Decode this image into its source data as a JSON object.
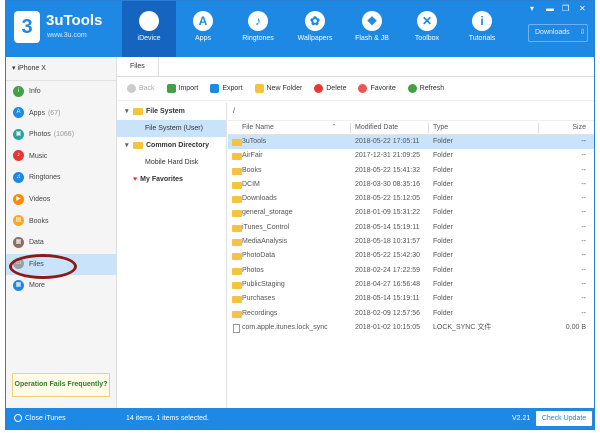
{
  "brand": {
    "name": "3uTools",
    "url": "www.3u.com",
    "logo_glyph": "3"
  },
  "nav": [
    {
      "label": "iDevice",
      "icon": "apple-icon",
      "glyph": "",
      "active": true
    },
    {
      "label": "Apps",
      "icon": "app-store-icon",
      "glyph": "A",
      "active": false
    },
    {
      "label": "Ringtones",
      "icon": "bell-icon",
      "glyph": "♪",
      "active": false
    },
    {
      "label": "Wallpapers",
      "icon": "flower-icon",
      "glyph": "✿",
      "active": false
    },
    {
      "label": "Flash & JB",
      "icon": "dropbox-icon",
      "glyph": "❖",
      "active": false
    },
    {
      "label": "Toolbox",
      "icon": "tools-icon",
      "glyph": "✕",
      "active": false
    },
    {
      "label": "Tutorials",
      "icon": "info-icon",
      "glyph": "i",
      "active": false
    }
  ],
  "downloads": {
    "label": "Downloads",
    "glyph": "⇩"
  },
  "window_controls": {
    "minimize": "▬",
    "restore": "❐",
    "close": "✕",
    "menu": "▾"
  },
  "sidebar": {
    "device": "iPhone X",
    "device_glyph": "▾",
    "items": [
      {
        "label": "Info",
        "count": "",
        "icon": "info-icon",
        "glyph": "i",
        "color": "#43a047"
      },
      {
        "label": "Apps",
        "count": "(67)",
        "icon": "apps-icon",
        "glyph": "A",
        "color": "#1e88e5"
      },
      {
        "label": "Photos",
        "count": "(1066)",
        "icon": "photos-icon",
        "glyph": "▣",
        "color": "#26a69a"
      },
      {
        "label": "Music",
        "count": "",
        "icon": "music-icon",
        "glyph": "♪",
        "color": "#e53935"
      },
      {
        "label": "Ringtones",
        "count": "",
        "icon": "bell-icon",
        "glyph": "♫",
        "color": "#1e88e5"
      },
      {
        "label": "Videos",
        "count": "",
        "icon": "video-icon",
        "glyph": "▶",
        "color": "#fb8c00"
      },
      {
        "label": "Books",
        "count": "",
        "icon": "book-icon",
        "glyph": "▤",
        "color": "#f9a825"
      },
      {
        "label": "Data",
        "count": "",
        "icon": "data-icon",
        "glyph": "▦",
        "color": "#8d6e63"
      },
      {
        "label": "Files",
        "count": "",
        "icon": "folder-icon",
        "glyph": "▭",
        "color": "#9e9e9e",
        "active": true
      },
      {
        "label": "More",
        "count": "",
        "icon": "grid-icon",
        "glyph": "▦",
        "color": "#1e88e5"
      }
    ],
    "help_link": "Operation Fails Frequently?"
  },
  "tabs": [
    {
      "label": "Files"
    }
  ],
  "toolbar": {
    "back": "Back",
    "import": "Import",
    "export": "Export",
    "new_folder": "New Folder",
    "delete": "Delete",
    "favorite": "Favorite",
    "refresh": "Refresh"
  },
  "tree": {
    "file_system": "File System",
    "file_system_user": "File System (User)",
    "common_directory": "Common Directory",
    "mobile_hard_disk": "Mobile Hard Disk",
    "my_favorites": "My Favorites"
  },
  "path": "/",
  "columns": {
    "name": "File Name",
    "date": "Modified Date",
    "type": "Type",
    "size": "Size"
  },
  "files": [
    {
      "name": "3uTools",
      "date": "2018-05-22 17:05:11",
      "type": "Folder",
      "size": "--",
      "kind": "folder"
    },
    {
      "name": "AirFair",
      "date": "2017-12-31 21:09:25",
      "type": "Folder",
      "size": "--",
      "kind": "folder"
    },
    {
      "name": "Books",
      "date": "2018-05-22 15:41:32",
      "type": "Folder",
      "size": "--",
      "kind": "folder"
    },
    {
      "name": "DCIM",
      "date": "2018-03-30 08:35:16",
      "type": "Folder",
      "size": "--",
      "kind": "folder"
    },
    {
      "name": "Downloads",
      "date": "2018-05-22 15:12:05",
      "type": "Folder",
      "size": "--",
      "kind": "folder"
    },
    {
      "name": "general_storage",
      "date": "2018-01-09 15:31:22",
      "type": "Folder",
      "size": "--",
      "kind": "folder"
    },
    {
      "name": "iTunes_Control",
      "date": "2018-05-14 15:19:11",
      "type": "Folder",
      "size": "--",
      "kind": "folder"
    },
    {
      "name": "MediaAnalysis",
      "date": "2018-05-18 10:31:57",
      "type": "Folder",
      "size": "--",
      "kind": "folder"
    },
    {
      "name": "PhotoData",
      "date": "2018-05-22 15:42:30",
      "type": "Folder",
      "size": "--",
      "kind": "folder"
    },
    {
      "name": "Photos",
      "date": "2018-02-24 17:22:59",
      "type": "Folder",
      "size": "--",
      "kind": "folder"
    },
    {
      "name": "PublicStaging",
      "date": "2018-04-27 16:56:48",
      "type": "Folder",
      "size": "--",
      "kind": "folder"
    },
    {
      "name": "Purchases",
      "date": "2018-05-14 15:19:11",
      "type": "Folder",
      "size": "--",
      "kind": "folder"
    },
    {
      "name": "Recordings",
      "date": "2018-02-09 12:57:56",
      "type": "Folder",
      "size": "--",
      "kind": "folder"
    },
    {
      "name": "com.apple.itunes.lock_sync",
      "date": "2018-01-02 10:15:05",
      "type": "LOCK_SYNC 文件",
      "size": "0.00 B",
      "kind": "file"
    }
  ],
  "status": {
    "close_itunes": "Close iTunes",
    "message": "14 items, 1 items selected.",
    "version": "V2.21",
    "check_update": "Check Update"
  },
  "colors": {
    "primary": "#1e88e5",
    "selected_row": "#c9e3fb",
    "folder": "#f5c242",
    "annotation_oval": "#8b1a1a"
  }
}
